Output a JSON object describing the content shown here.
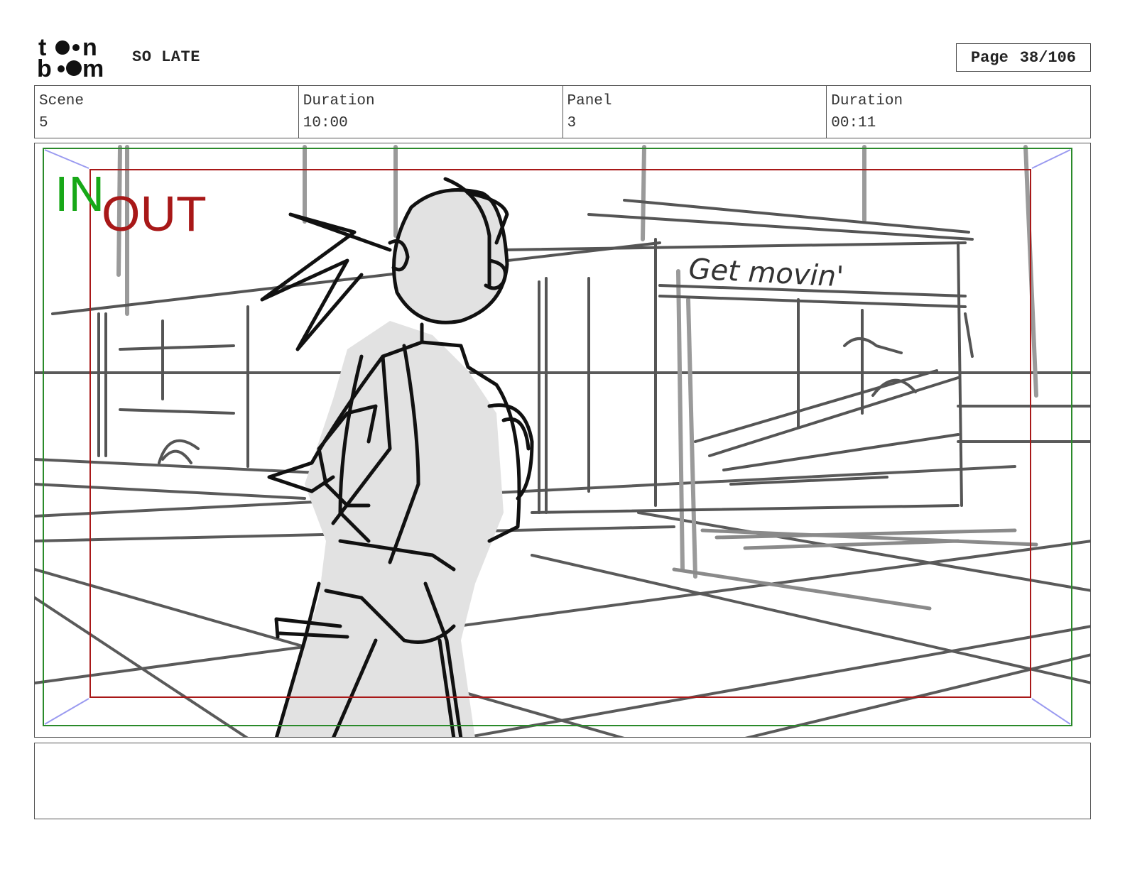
{
  "header": {
    "logo_text": "toon boom",
    "project_title": "SO LATE",
    "page_label": "Page",
    "page_number": "38/106"
  },
  "info": {
    "scene_label": "Scene",
    "scene_value": "5",
    "duration_label": "Duration",
    "duration_value": "10:00",
    "panel_label": "Panel",
    "panel_value": "3",
    "panel_duration_label": "Duration",
    "panel_duration_value": "00:11"
  },
  "panel": {
    "in_label": "IN",
    "out_label": "OUT",
    "sign_text": "Get movin'"
  },
  "notes": {
    "text": ""
  },
  "colors": {
    "in_frame": "#2a8a2a",
    "out_frame": "#a81818",
    "sketch_dark": "#111111",
    "sketch_gray": "#666666",
    "fill_gray": "#e2e2e2"
  }
}
